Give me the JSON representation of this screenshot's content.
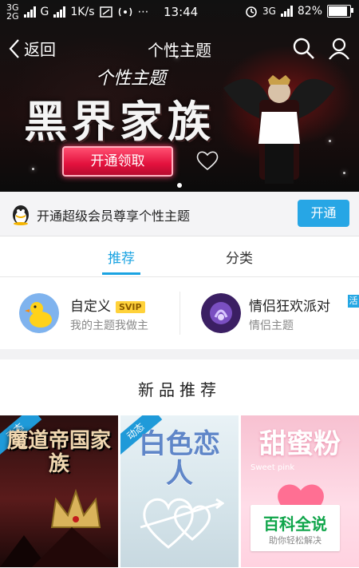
{
  "status_bar": {
    "left_network_top": "3G",
    "left_network_bottom": "2G",
    "mid_network": "G",
    "speed": "1K/s",
    "time": "13:44",
    "right_network": "3G",
    "battery": "82%"
  },
  "header": {
    "back_label": "返回",
    "title": "个性主题"
  },
  "banner": {
    "subtitle": "个性主题",
    "big_title": "黑界家族",
    "button_label": "开通领取",
    "dot_count": 1
  },
  "vip_strip": {
    "text": "开通超级会员尊享个性主题",
    "button_label": "开通"
  },
  "tabs": [
    {
      "label": "推荐",
      "active": true
    },
    {
      "label": "分类",
      "active": false
    }
  ],
  "categories": [
    {
      "name": "自定义",
      "badge": "SVIP",
      "subtitle": "我的主题我做主"
    },
    {
      "name": "情侣狂欢派对",
      "badge": "活",
      "subtitle": "情侣主题"
    }
  ],
  "new_section": {
    "title": "新品推荐",
    "cards": [
      {
        "corner": "动态",
        "title": "魔道帝国家族"
      },
      {
        "corner": "动态",
        "title": "白色恋人"
      },
      {
        "title": "甜蜜粉",
        "subtitle": "Sweet pink"
      }
    ]
  },
  "watermark": {
    "title": "百科全说",
    "subtitle": "助你轻松解决"
  },
  "colors": {
    "accent_blue": "#1aa3e2",
    "svip_gold": "#ffd23a",
    "banner_button_red": "#e3113d",
    "watermark_green": "#0fa54a"
  }
}
